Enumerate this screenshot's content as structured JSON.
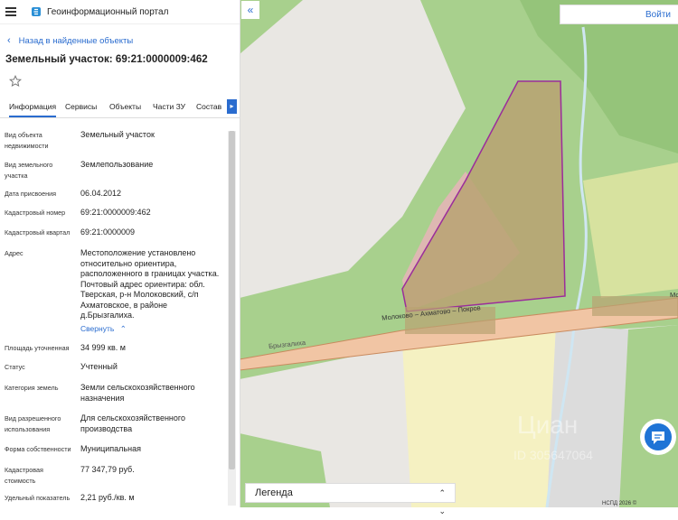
{
  "app": {
    "title": "Геоинформационный портал"
  },
  "nav": {
    "back_label": "Назад в найденные объекты"
  },
  "object": {
    "title": "Земельный участок: 69:21:0000009:462"
  },
  "tabs": [
    {
      "label": "Информация"
    },
    {
      "label": "Сервисы"
    },
    {
      "label": "Объекты"
    },
    {
      "label": "Части ЗУ"
    },
    {
      "label": "Состав"
    }
  ],
  "fields": {
    "type": {
      "label": "Вид объекта недвижимости",
      "value": "Земельный участок"
    },
    "land_type": {
      "label": "Вид земельного участка",
      "value": "Землепользование"
    },
    "date": {
      "label": "Дата присвоения",
      "value": "06.04.2012"
    },
    "cadnum": {
      "label": "Кадастровый номер",
      "value": "69:21:0000009:462"
    },
    "quarter": {
      "label": "Кадастровый квартал",
      "value": "69:21:0000009"
    },
    "address": {
      "label": "Адрес",
      "value": "Местоположение установлено относительно ориентира, расположенного в границах участка. Почтовый адрес ориентира: обл. Тверская, р-н Молоковский, с/п Ахматовское, в районе д.Брызгалиха.",
      "collapse": "Свернуть"
    },
    "area": {
      "label": "Площадь уточненная",
      "value": "34 999 кв. м"
    },
    "status": {
      "label": "Статус",
      "value": "Учтенный"
    },
    "category": {
      "label": "Категория земель",
      "value": "Земли сельскохозяйственного назначения"
    },
    "permitted_use": {
      "label": "Вид разрешенного использования",
      "value": "Для сельскохозяйственного производства"
    },
    "ownership": {
      "label": "Форма собственности",
      "value": "Муниципальная"
    },
    "cad_value": {
      "label": "Кадастровая стоимость",
      "value": "77 347,79 руб."
    },
    "unit_value": {
      "label": "Удельный показатель",
      "value": "2,21 руб./кв. м"
    }
  },
  "map": {
    "login": "Войти",
    "legend": "Легенда",
    "road_label": "Молоково – Ахматово – Покров",
    "road_label_end": "Мо",
    "village_label": "Брызгалиха",
    "watermark": "Циан",
    "watermark_id": "ID 305647064",
    "copyright": "НСПД 2026 ©",
    "colors": {
      "forest": "#a8d08d",
      "parcel_fill": "#b9a272",
      "parcel_border": "#9b2d9b",
      "road": "#f1c5a4",
      "field": "#f5f1c2"
    }
  }
}
